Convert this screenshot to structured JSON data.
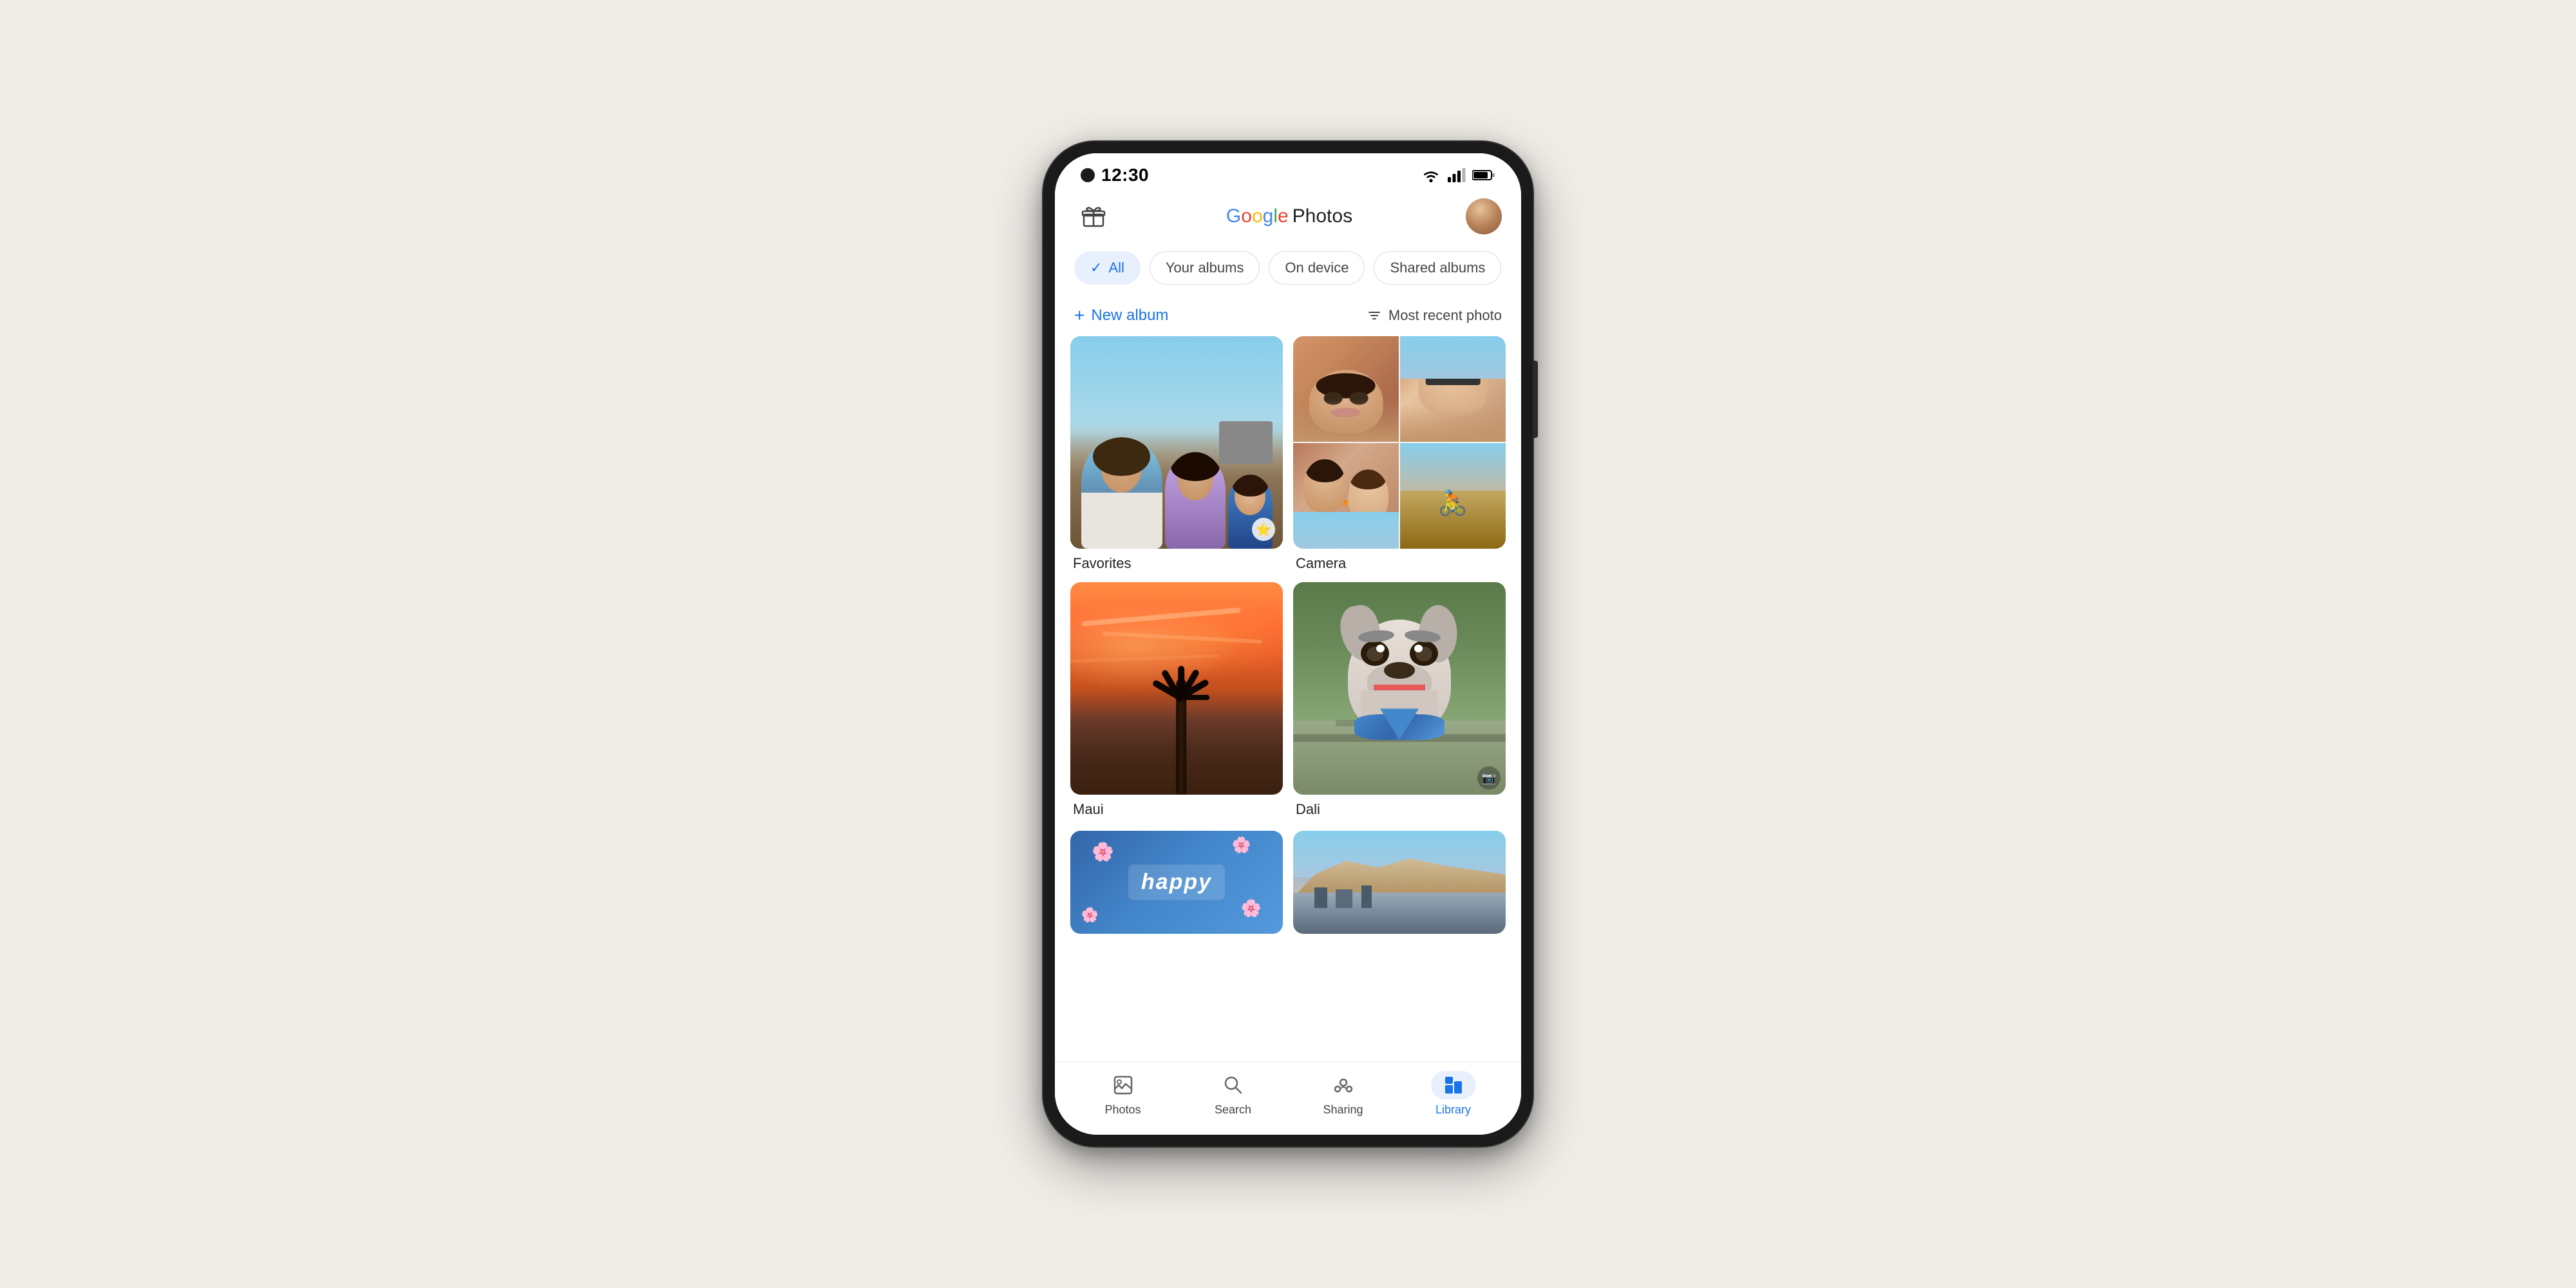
{
  "phone": {
    "status_bar": {
      "time": "12:30"
    },
    "app_bar": {
      "logo": {
        "google": "Google",
        "photos": " Photos"
      }
    },
    "filter_tabs": [
      {
        "id": "all",
        "label": "All",
        "active": true
      },
      {
        "id": "your_albums",
        "label": "Your albums",
        "active": false
      },
      {
        "id": "on_device",
        "label": "On device",
        "active": false
      },
      {
        "id": "shared_albums",
        "label": "Shared albums",
        "active": false
      }
    ],
    "action_bar": {
      "new_album": "+ New album",
      "sort": "Most recent photo"
    },
    "albums": [
      {
        "id": "favorites",
        "name": "Favorites",
        "type": "favorites"
      },
      {
        "id": "camera",
        "name": "Camera",
        "type": "camera"
      },
      {
        "id": "maui",
        "name": "Maui",
        "type": "maui"
      },
      {
        "id": "dali",
        "name": "Dali",
        "type": "dali"
      },
      {
        "id": "happy",
        "name": "",
        "type": "happy"
      },
      {
        "id": "city",
        "name": "",
        "type": "city"
      }
    ],
    "bottom_nav": [
      {
        "id": "photos",
        "label": "Photos",
        "active": false
      },
      {
        "id": "search",
        "label": "Search",
        "active": false
      },
      {
        "id": "sharing",
        "label": "Sharing",
        "active": false
      },
      {
        "id": "library",
        "label": "Library",
        "active": true
      }
    ]
  }
}
